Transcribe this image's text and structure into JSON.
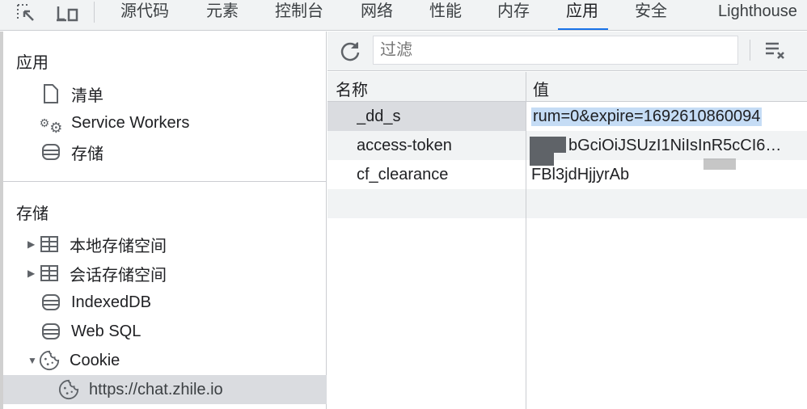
{
  "tabs": [
    {
      "label": "源代码"
    },
    {
      "label": "元素"
    },
    {
      "label": "控制台"
    },
    {
      "label": "网络"
    },
    {
      "label": "性能"
    },
    {
      "label": "内存"
    },
    {
      "label": "应用",
      "active": true
    },
    {
      "label": "安全"
    },
    {
      "label": "Lighthouse"
    }
  ],
  "sidebar": {
    "app_title": "应用",
    "app_items": [
      {
        "label": "清单",
        "icon": "document-icon"
      },
      {
        "label": "Service Workers",
        "icon": "gears-icon"
      },
      {
        "label": "存储",
        "icon": "database-icon"
      }
    ],
    "storage_title": "存储",
    "storage_items": [
      {
        "label": "本地存储空间",
        "icon": "table-icon",
        "expander": "collapsed"
      },
      {
        "label": "会话存储空间",
        "icon": "table-icon",
        "expander": "collapsed"
      },
      {
        "label": "IndexedDB",
        "icon": "database-icon"
      },
      {
        "label": "Web SQL",
        "icon": "database-icon"
      },
      {
        "label": "Cookie",
        "icon": "cookie-icon",
        "expander": "expanded"
      },
      {
        "label": "https://chat.zhile.io",
        "icon": "cookie-icon",
        "selected": true
      }
    ]
  },
  "toolbar": {
    "filter_placeholder": "过滤"
  },
  "table": {
    "columns": [
      "名称",
      "值"
    ],
    "rows": [
      {
        "name": "_dd_s",
        "value": "rum=0&expire=1692610860094",
        "selected": true
      },
      {
        "name": "access-token",
        "value": "bGciOiJSUzI1NiIsInR5cCI6…"
      },
      {
        "name": "cf_clearance",
        "value": "FBl3jdHjjyrAb"
      }
    ]
  },
  "colors": {
    "accent": "#1a73e8",
    "selection": "#c5dcf5",
    "selected_row": "#dadce0"
  }
}
